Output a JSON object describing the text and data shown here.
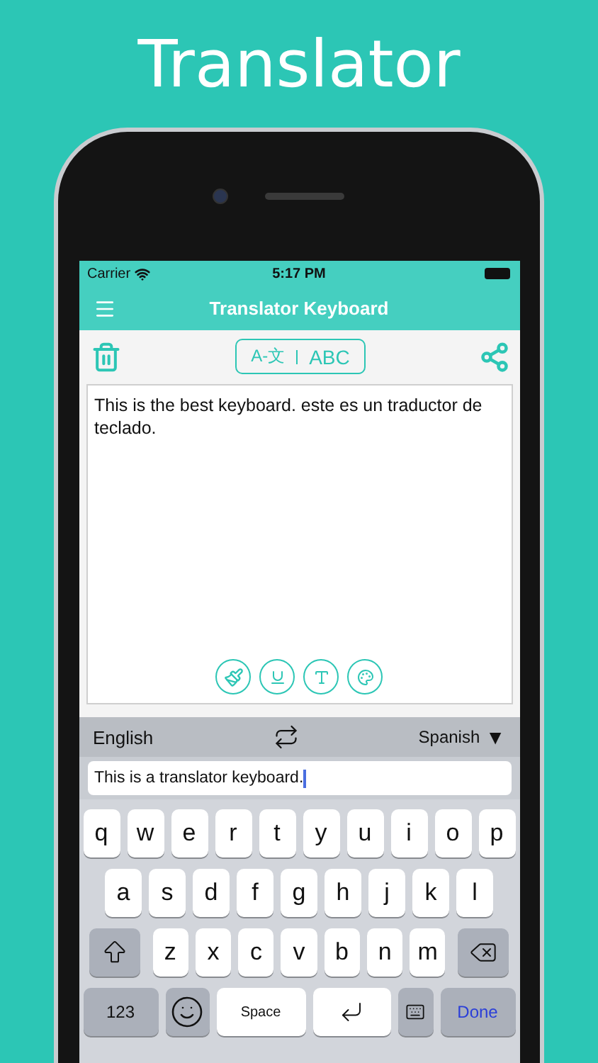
{
  "headline": "Translator",
  "status_bar": {
    "carrier": "Carrier",
    "time": "5:17 PM"
  },
  "nav_bar": {
    "title": "Translator Keyboard"
  },
  "toolbar": {
    "mode_toggle": [
      "A-文",
      "ABC"
    ]
  },
  "editor": {
    "text": "This is the best keyboard. este es un traductor de teclado."
  },
  "language_bar": {
    "source": "English",
    "target": "Spanish",
    "target_caret": "▼"
  },
  "input": {
    "value": "This is a translator keyboard."
  },
  "keyboard": {
    "rows": [
      {
        "keys": [
          {
            "kind": "letter",
            "label": "q"
          },
          {
            "kind": "letter",
            "label": "w"
          },
          {
            "kind": "letter",
            "label": "e"
          },
          {
            "kind": "letter",
            "label": "r"
          },
          {
            "kind": "letter",
            "label": "t"
          },
          {
            "kind": "letter",
            "label": "y"
          },
          {
            "kind": "letter",
            "label": "u"
          },
          {
            "kind": "letter",
            "label": "i"
          },
          {
            "kind": "letter",
            "label": "o"
          },
          {
            "kind": "letter",
            "label": "p"
          }
        ]
      },
      {
        "keys": [
          {
            "kind": "letter",
            "label": "a"
          },
          {
            "kind": "letter",
            "label": "s"
          },
          {
            "kind": "letter",
            "label": "d"
          },
          {
            "kind": "letter",
            "label": "f"
          },
          {
            "kind": "letter",
            "label": "g"
          },
          {
            "kind": "letter",
            "label": "h"
          },
          {
            "kind": "letter",
            "label": "j"
          },
          {
            "kind": "letter",
            "label": "k"
          },
          {
            "kind": "letter",
            "label": "l"
          }
        ]
      },
      {
        "keys": [
          {
            "kind": "shift"
          },
          {
            "kind": "letter",
            "label": "z"
          },
          {
            "kind": "letter",
            "label": "x"
          },
          {
            "kind": "letter",
            "label": "c"
          },
          {
            "kind": "letter",
            "label": "v"
          },
          {
            "kind": "letter",
            "label": "b"
          },
          {
            "kind": "letter",
            "label": "n"
          },
          {
            "kind": "letter",
            "label": "m"
          },
          {
            "kind": "backspace"
          }
        ]
      },
      {
        "keys": [
          {
            "kind": "mode",
            "label": "123"
          },
          {
            "kind": "emoji"
          },
          {
            "kind": "space",
            "label": "Space"
          },
          {
            "kind": "return"
          },
          {
            "kind": "keyboard"
          },
          {
            "kind": "done",
            "label": "Done"
          }
        ]
      }
    ]
  }
}
